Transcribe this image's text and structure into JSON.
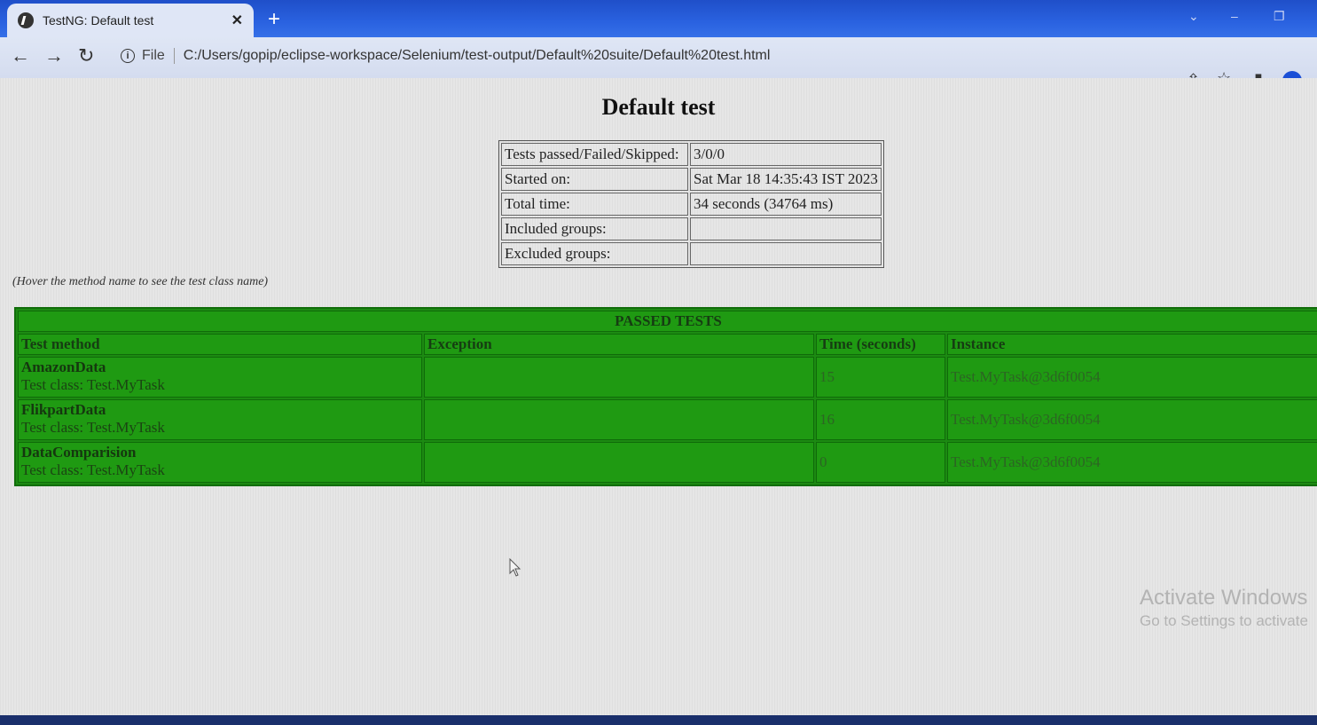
{
  "browser": {
    "tab_title": "TestNG: Default test",
    "new_tab_symbol": "+",
    "url_prefix": "File",
    "url": "C:/Users/gopip/eclipse-workspace/Selenium/test-output/Default%20suite/Default%20test.html",
    "icons": [
      "back-icon",
      "forward-icon",
      "reload-icon",
      "info-icon",
      "share-icon",
      "star-icon",
      "sidebar-icon",
      "profile-icon"
    ]
  },
  "page": {
    "heading": "Default test",
    "summary": [
      {
        "label": "Tests passed/Failed/Skipped:",
        "value": "3/0/0"
      },
      {
        "label": "Started on:",
        "value": "Sat Mar 18 14:35:43 IST 2023"
      },
      {
        "label": "Total time:",
        "value": "34 seconds (34764 ms)"
      },
      {
        "label": "Included groups:",
        "value": ""
      },
      {
        "label": "Excluded groups:",
        "value": ""
      }
    ],
    "hover_note": "(Hover the method name to see the test class name)",
    "passed": {
      "title": "PASSED TESTS",
      "columns": [
        "Test method",
        "Exception",
        "Time (seconds)",
        "Instance"
      ],
      "rows": [
        {
          "method": "AmazonData",
          "class_label": "Test class: Test.MyTask",
          "exception": "",
          "time": "15",
          "instance": "Test.MyTask@3d6f0054"
        },
        {
          "method": "FlikpartData",
          "class_label": "Test class: Test.MyTask",
          "exception": "",
          "time": "16",
          "instance": "Test.MyTask@3d6f0054"
        },
        {
          "method": "DataComparision",
          "class_label": "Test class: Test.MyTask",
          "exception": "",
          "time": "0",
          "instance": "Test.MyTask@3d6f0054"
        }
      ]
    },
    "colors": {
      "passed_bg": "#1f9a12",
      "tab_strip": "#2a62e0"
    }
  },
  "watermark": {
    "line1": "Activate Windows",
    "line2": "Go to Settings to activate"
  }
}
